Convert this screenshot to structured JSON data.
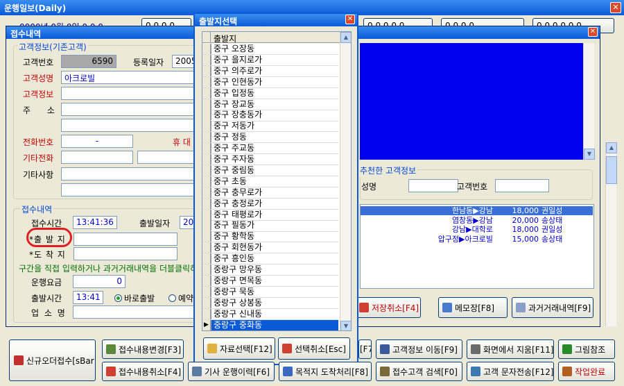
{
  "app": {
    "title": "운행일보(Daily)"
  },
  "bg_toolbar": {
    "left_text": "0000년 0월 0일 0 0 0",
    "btn1": "0 0 0 0",
    "btn2": "0 0 0 0 0",
    "btn3": "0 0 0 0",
    "btn4": "0 0 0 0 0 0"
  },
  "reception_window": {
    "title": "접수내역",
    "customer_group": "고객정보(기존고객)",
    "customer_no_label": "고객번호",
    "customer_no_value": "6590",
    "reg_date_label": "등록일자",
    "reg_date_value": "2005",
    "customer_name_label": "고객성명",
    "customer_name_value": "아크로빌",
    "customer_info_label": "고객정보",
    "address_label": "주 소",
    "phone_label": "전화번호",
    "phone_value": "-",
    "mobile_label": "휴 대",
    "other_phone_label": "기타전화",
    "notes_label": "기타사항",
    "reception_group": "접수내역",
    "reception_time_label": "접수시간",
    "reception_time_value": "13:41:36",
    "departure_date_label": "출발일자",
    "departure_date_value": "200",
    "departure_label": "*출 발 지",
    "arrival_label": "*도 착 지",
    "hint_text": "구간을 직접 입력하거나 과거거래내역을 더블클릭하",
    "fare_label": "운행요금",
    "fare_value": "0",
    "depart_time_label": "출발시간",
    "depart_time_value": "13:41",
    "radio_now": "바로출발",
    "radio_reserve": "예약",
    "company_label": "업 소 명",
    "recommended_group": "추천한 고객정보",
    "rec_name_label": "성명",
    "rec_no_label": "고객번호",
    "history": [
      {
        "route": "한남동▶강남",
        "fare": "18,000",
        "driver": "권일성"
      },
      {
        "route": "염창동▶강남",
        "fare": "20,000",
        "driver": "송상태"
      },
      {
        "route": "강남▶대학로",
        "fare": "18,000",
        "driver": "권일성"
      },
      {
        "route": "압구정▶아크로빌",
        "fare": "15,000",
        "driver": "송상태"
      }
    ],
    "btn_cancel_save": "저장취소[F4]",
    "btn_memo": "메모장[F8]",
    "btn_history": "과거거래내역[F9]"
  },
  "picker": {
    "title": "출발지선택",
    "column": "출발지",
    "items": [
      "중구 오장동",
      "중구 을지로가",
      "중구 의주로가",
      "중구 인현동가",
      "중구 입정동",
      "중구 장교동",
      "중구 장충동가",
      "중구 저동가",
      "중구 정동",
      "중구 주교동",
      "중구 주자동",
      "중구 중림동",
      "중구 초동",
      "중구 충무로가",
      "중구 충정로가",
      "중구 태평로가",
      "중구 필동가",
      "중구 황학동",
      "중구 회현동가",
      "중구 흥인동",
      "중랑구 망우동",
      "중랑구 면목동",
      "중랑구 묵동",
      "중랑구 상봉동",
      "중랑구 신내동",
      "중랑구 중화동"
    ],
    "selected_index": 25,
    "btn_select": "자료선택[F12]",
    "btn_cancel": "선택취소[Esc]"
  },
  "bottom": {
    "new_order": "신규오더접수[sBar]",
    "edit": "접수내용변경[F3]",
    "cancel": "접수내용취소[F4]",
    "history": "기사 운행이력[F6]",
    "dest": "목적지 도착처리[F8]",
    "hidden_f7": "[F7]",
    "move": "고객정보 이동[F9]",
    "search": "접수고객 검색[F0]",
    "clear": "화면에서 지움[F11]",
    "sms": "고객 문자전송[F12]",
    "picture": "그림참조",
    "done": "작업완료"
  },
  "colors": {
    "titlebar": "#0a5ad8",
    "blue_panel": "#0000ee",
    "selection": "#0a5ad8",
    "red_label": "#c00000"
  }
}
